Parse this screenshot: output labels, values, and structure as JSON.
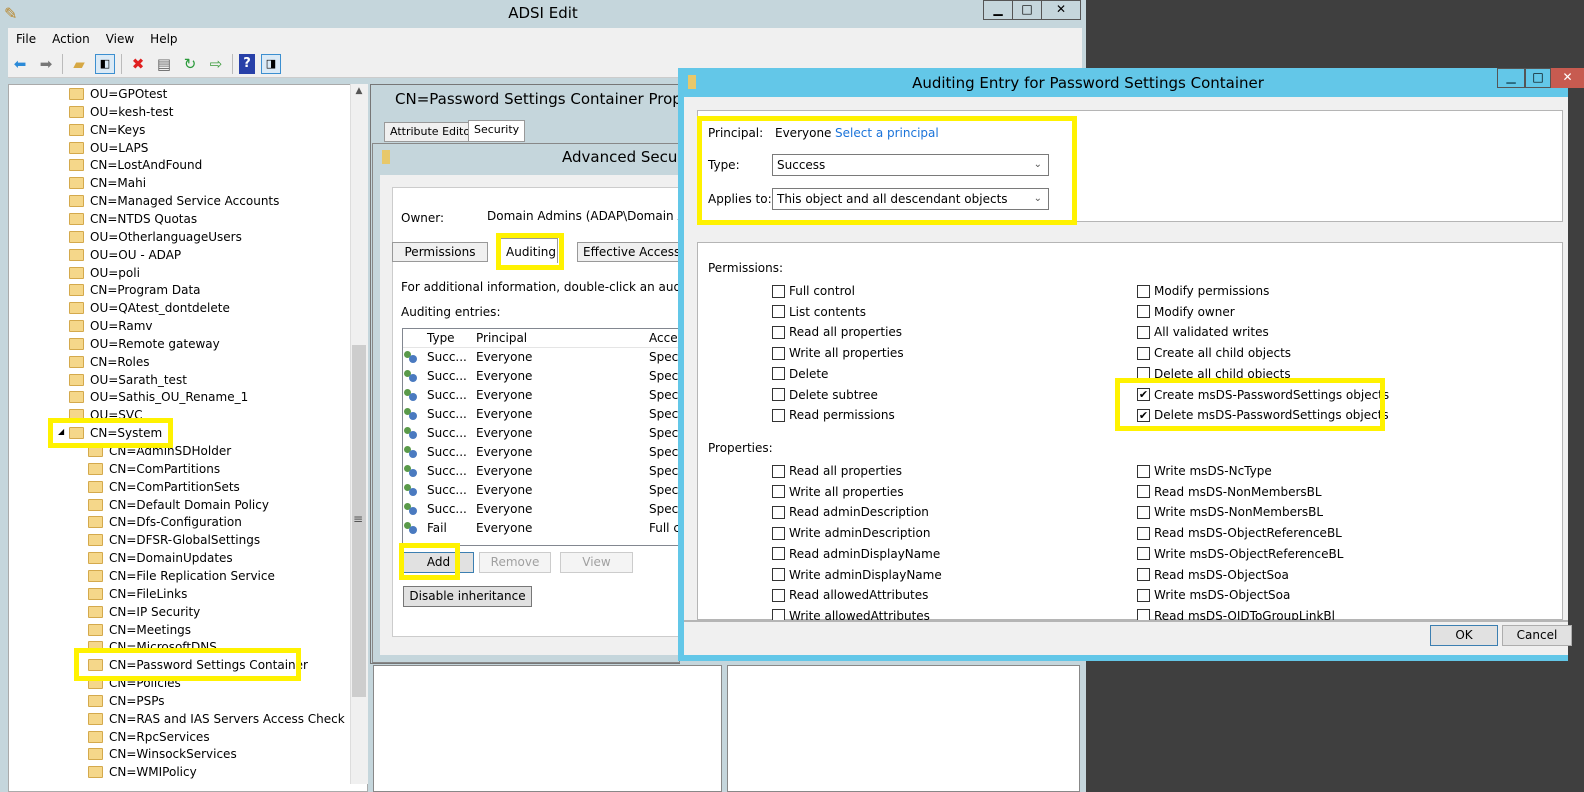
{
  "main": {
    "title": "ADSI Edit",
    "menu": [
      "File",
      "Action",
      "View",
      "Help"
    ],
    "toolbar_icons": [
      "back-arrow-icon",
      "forward-arrow-icon",
      "up-folder-icon",
      "show-hide-tree-icon",
      "delete-icon",
      "properties-icon",
      "refresh-icon",
      "export-list-icon",
      "help-icon",
      "action-pane-icon"
    ]
  },
  "tree": {
    "items": [
      "OU=GPOtest",
      "OU=kesh-test",
      "CN=Keys",
      "OU=LAPS",
      "CN=LostAndFound",
      "CN=Mahi",
      "CN=Managed Service Accounts",
      "CN=NTDS Quotas",
      "OU=OtherlanguageUsers",
      "OU=OU - ADAP",
      "OU=poli",
      "CN=Program Data",
      "OU=QAtest_dontdelete",
      "OU=Ramv",
      "OU=Remote gateway",
      "CN=Roles",
      "OU=Sarath_test",
      "OU=Sathis_OU_Rename_1",
      "OU=SVC"
    ],
    "expanded": "CN=System",
    "children": [
      "CN=AdminSDHolder",
      "CN=ComPartitions",
      "CN=ComPartitionSets",
      "CN=Default Domain Policy",
      "CN=Dfs-Configuration",
      "CN=DFSR-GlobalSettings",
      "CN=DomainUpdates",
      "CN=File Replication Service",
      "CN=FileLinks",
      "CN=IP Security",
      "CN=Meetings",
      "CN=MicrosoftDNS",
      "CN=Password Settings Container",
      "CN=Policies",
      "CN=PSPs",
      "CN=RAS and IAS Servers Access Check",
      "CN=RpcServices",
      "CN=WinsockServices",
      "CN=WMIPolicy"
    ],
    "selected": "CN=Password Settings Container"
  },
  "properties": {
    "title": "CN=Password Settings Container Properties",
    "tabs": [
      "Attribute Editor",
      "Security"
    ],
    "active_tab": "Security"
  },
  "advanced": {
    "title": "Advanced Security",
    "owner_label": "Owner:",
    "owner_value": "Domain Admins (ADAP\\Domain Adr",
    "tabs": [
      "Permissions",
      "Auditing",
      "Effective Access"
    ],
    "active_tab": "Auditing",
    "info": "For additional information, double-click an audit entr",
    "entries_label": "Auditing entries:",
    "columns": [
      "Type",
      "Principal",
      "Acces"
    ],
    "rows": [
      [
        "Succ...",
        "Everyone",
        "Specia"
      ],
      [
        "Succ...",
        "Everyone",
        "Specia"
      ],
      [
        "Succ...",
        "Everyone",
        "Specia"
      ],
      [
        "Succ...",
        "Everyone",
        "Specia"
      ],
      [
        "Succ...",
        "Everyone",
        "Specia"
      ],
      [
        "Succ...",
        "Everyone",
        "Specia"
      ],
      [
        "Succ...",
        "Everyone",
        "Specia"
      ],
      [
        "Succ...",
        "Everyone",
        "Specia"
      ],
      [
        "Succ...",
        "Everyone",
        "Specia"
      ],
      [
        "Fail",
        "Everyone",
        "Full c"
      ]
    ],
    "buttons": {
      "add": "Add",
      "remove": "Remove",
      "view": "View",
      "disable": "Disable inheritance"
    }
  },
  "audit": {
    "title": "Auditing Entry for Password Settings Container",
    "principal_label": "Principal:",
    "principal": "Everyone",
    "select_principal": "Select a principal",
    "type_label": "Type:",
    "type_value": "Success",
    "applies_label": "Applies to:",
    "applies_value": "This object and all descendant objects",
    "permissions_label": "Permissions:",
    "permissions_left": [
      {
        "label": "Full control",
        "checked": false
      },
      {
        "label": "List contents",
        "checked": false
      },
      {
        "label": "Read all properties",
        "checked": false
      },
      {
        "label": "Write all properties",
        "checked": false
      },
      {
        "label": "Delete",
        "checked": false
      },
      {
        "label": "Delete subtree",
        "checked": false
      },
      {
        "label": "Read permissions",
        "checked": false
      }
    ],
    "permissions_right": [
      {
        "label": "Modify permissions",
        "checked": false
      },
      {
        "label": "Modify owner",
        "checked": false
      },
      {
        "label": "All validated writes",
        "checked": false
      },
      {
        "label": "Create all child objects",
        "checked": false
      },
      {
        "label": "Delete all child objects",
        "checked": false
      },
      {
        "label": "Create msDS-PasswordSettings objects",
        "checked": true
      },
      {
        "label": "Delete msDS-PasswordSettings objects",
        "checked": true
      }
    ],
    "properties_label": "Properties:",
    "properties_left": [
      {
        "label": "Read all properties",
        "checked": false
      },
      {
        "label": "Write all properties",
        "checked": false
      },
      {
        "label": "Read adminDescription",
        "checked": false
      },
      {
        "label": "Write adminDescription",
        "checked": false
      },
      {
        "label": "Read adminDisplayName",
        "checked": false
      },
      {
        "label": "Write adminDisplayName",
        "checked": false
      },
      {
        "label": "Read allowedAttributes",
        "checked": false
      },
      {
        "label": "Write allowedAttributes",
        "checked": false
      }
    ],
    "properties_right": [
      {
        "label": "Write msDS-NcType",
        "checked": false
      },
      {
        "label": "Read msDS-NonMembersBL",
        "checked": false
      },
      {
        "label": "Write msDS-NonMembersBL",
        "checked": false
      },
      {
        "label": "Read msDS-ObjectReferenceBL",
        "checked": false
      },
      {
        "label": "Write msDS-ObjectReferenceBL",
        "checked": false
      },
      {
        "label": "Read msDS-ObjectSoa",
        "checked": false
      },
      {
        "label": "Write msDS-ObjectSoa",
        "checked": false
      },
      {
        "label": "Read msDS-OIDToGroupLinkBl",
        "checked": false
      }
    ],
    "ok": "OK",
    "cancel": "Cancel"
  },
  "colors": {
    "highlight": "#fff200",
    "dialog_accent": "#63c7e8",
    "link": "#1a73d9"
  }
}
